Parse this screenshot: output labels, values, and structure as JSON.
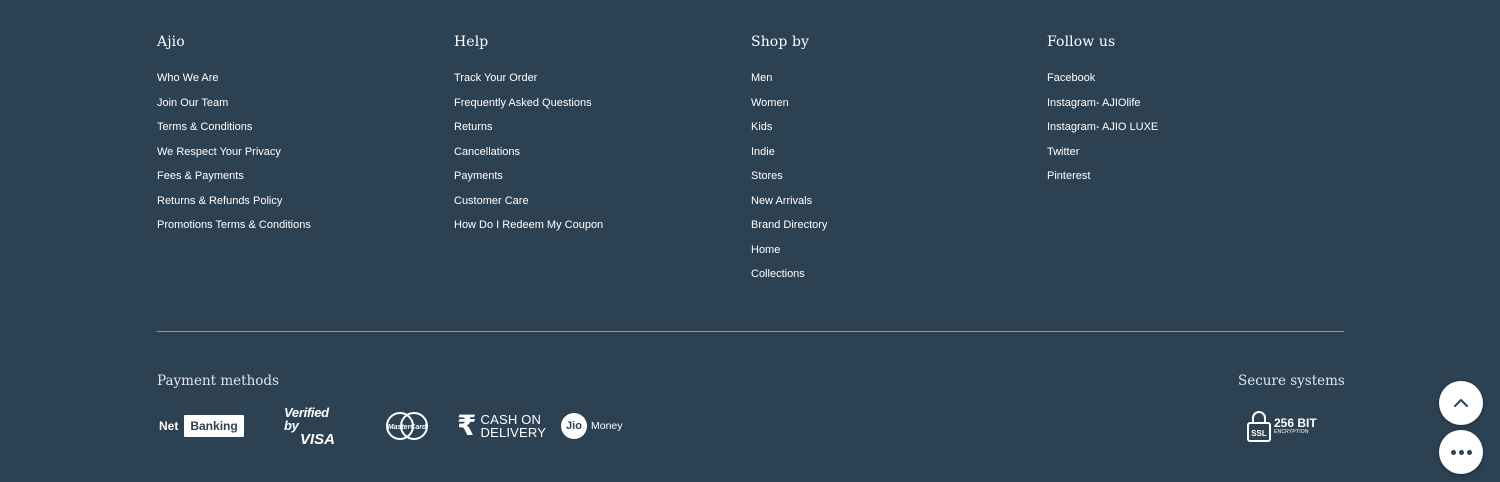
{
  "columns": [
    {
      "title": "Ajio",
      "links": [
        "Who We Are",
        "Join Our Team",
        "Terms & Conditions",
        "We Respect Your Privacy",
        "Fees & Payments",
        "Returns & Refunds Policy",
        "Promotions Terms & Conditions"
      ]
    },
    {
      "title": "Help",
      "links": [
        "Track Your Order",
        "Frequently Asked Questions",
        "Returns",
        "Cancellations",
        "Payments",
        "Customer Care",
        "How Do I Redeem My Coupon"
      ]
    },
    {
      "title": "Shop by",
      "links": [
        "Men",
        "Women",
        "Kids",
        "Indie",
        "Stores",
        "New Arrivals",
        "Brand Directory",
        "Home",
        "Collections"
      ]
    },
    {
      "title": "Follow us",
      "links": [
        "Facebook",
        "Instagram- AJIOlife",
        "Instagram- AJIO LUXE",
        "Twitter",
        "Pinterest"
      ]
    }
  ],
  "payment": {
    "title": "Payment methods",
    "net_label": "Net",
    "banking_label": "Banking",
    "visa_line1": "Verified by",
    "visa_line2": "VISA",
    "mastercard_label": "MasterCard",
    "cod_symbol": "₹",
    "cod_line1": "CASH ON",
    "cod_line2": "DELIVERY",
    "jio_label": "Jio",
    "jio_money_label": "Money"
  },
  "secure": {
    "title": "Secure systems",
    "ssl_label": "SSL",
    "bit_label": "256 BIT",
    "encryption_label": "ENCRYPTION"
  },
  "icons": {
    "scroll_top": "chevron-up-icon",
    "more": "more-dots-icon"
  },
  "colors": {
    "background": "#2c4152",
    "text": "#ffffff"
  }
}
